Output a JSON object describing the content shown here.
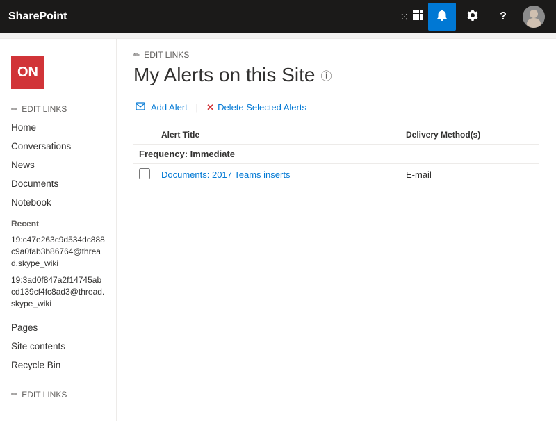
{
  "topbar": {
    "title": "SharePoint",
    "icons": {
      "grid": "⊞",
      "bell": "🔔",
      "settings": "⚙",
      "help": "?",
      "avatar_label": "User Avatar"
    }
  },
  "site": {
    "logo_text": "ON",
    "logo_bg": "#d13438"
  },
  "edit_links_top": "EDIT LINKS",
  "edit_links_bottom": "EDIT LINKS",
  "page_title": "My Alerts on this Site",
  "sidebar": {
    "nav_items": [
      {
        "label": "Home"
      },
      {
        "label": "Conversations"
      },
      {
        "label": "News"
      },
      {
        "label": "Documents"
      },
      {
        "label": "Notebook"
      }
    ],
    "recent_label": "Recent",
    "recent_items": [
      {
        "label": "19:c47e263c9d534dc888c9a0fab3b86764@thread.skype_wiki"
      },
      {
        "label": "19:3ad0f847a2f14745abcd139cf4fc8ad3@thread.skype_wiki"
      }
    ],
    "bottom_items": [
      {
        "label": "Pages"
      },
      {
        "label": "Site contents"
      },
      {
        "label": "Recycle Bin"
      }
    ]
  },
  "toolbar": {
    "add_alert_label": "Add Alert",
    "separator": "|",
    "delete_label": "Delete Selected Alerts"
  },
  "table": {
    "column_title": "Alert Title",
    "column_delivery": "Delivery Method(s)",
    "frequency_label": "Frequency: Immediate",
    "rows": [
      {
        "title": "Documents: 2017 Teams inserts",
        "delivery": "E-mail"
      }
    ]
  },
  "icons": {
    "pencil": "✏",
    "add_alert": "📧",
    "delete": "✕",
    "info": "ℹ"
  }
}
